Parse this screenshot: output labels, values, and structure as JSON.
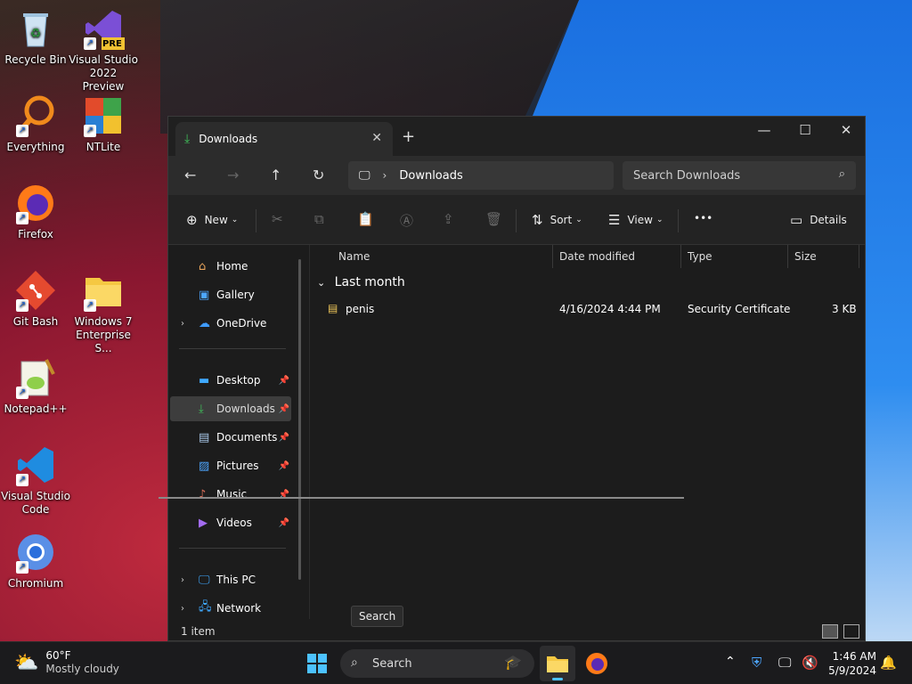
{
  "desktop": {
    "icons": [
      {
        "label": "Recycle Bin"
      },
      {
        "label": "Visual Studio 2022 Preview",
        "badge": "PRE"
      },
      {
        "label": "Everything"
      },
      {
        "label": "NTLite"
      },
      {
        "label": "Firefox"
      },
      {
        "label": "Git Bash"
      },
      {
        "label": "Windows 7 Enterprise S..."
      },
      {
        "label": "Notepad++"
      },
      {
        "label": "Visual Studio Code"
      },
      {
        "label": "Chromium"
      }
    ]
  },
  "explorer": {
    "tab_label": "Downloads",
    "address": {
      "location": "Downloads"
    },
    "search_placeholder": "Search Downloads",
    "toolbar": {
      "new_label": "New",
      "sort_label": "Sort",
      "view_label": "View",
      "more_label": "•••",
      "details_label": "Details"
    },
    "sidebar": {
      "top": [
        {
          "label": "Home",
          "icon": "home-icon"
        },
        {
          "label": "Gallery",
          "icon": "gallery-icon"
        },
        {
          "label": "OneDrive",
          "icon": "cloud-icon"
        }
      ],
      "quick": [
        {
          "label": "Desktop",
          "icon": "desktop-icon"
        },
        {
          "label": "Downloads",
          "icon": "download-icon"
        },
        {
          "label": "Documents",
          "icon": "documents-icon"
        },
        {
          "label": "Pictures",
          "icon": "pictures-icon"
        },
        {
          "label": "Music",
          "icon": "music-icon"
        },
        {
          "label": "Videos",
          "icon": "videos-icon"
        }
      ],
      "bottom": [
        {
          "label": "This PC",
          "icon": "pc-icon"
        },
        {
          "label": "Network",
          "icon": "network-icon"
        }
      ]
    },
    "columns": {
      "name": "Name",
      "date": "Date modified",
      "type": "Type",
      "size": "Size"
    },
    "group_label": "Last month",
    "files": [
      {
        "name": "penis",
        "date": "4/16/2024 4:44 PM",
        "type": "Security Certificate",
        "size": "3 KB"
      }
    ],
    "status": "1 item",
    "tooltip": "Search"
  },
  "taskbar": {
    "weather_temp": "60°F",
    "weather_desc": "Mostly cloudy",
    "search_label": "Search",
    "time": "1:46 AM",
    "date": "5/9/2024"
  },
  "colors": {
    "accent": "#0078d4",
    "window_bg": "#1c1c1c",
    "taskbar_bg": "#1b1b1d"
  }
}
